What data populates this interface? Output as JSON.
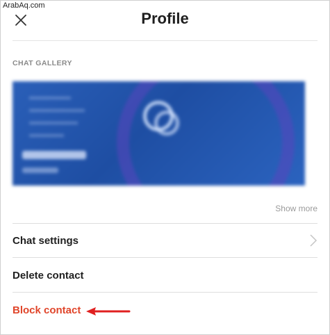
{
  "watermark": "ArabAq.com",
  "header": {
    "title": "Profile"
  },
  "gallery": {
    "section_label": "CHAT GALLERY",
    "show_more": "Show more"
  },
  "menu": {
    "chat_settings": "Chat settings",
    "delete_contact": "Delete contact",
    "block_contact": "Block contact"
  },
  "colors": {
    "danger": "#e0452a",
    "arrow": "#e02020"
  },
  "icons": {
    "close": "close-icon",
    "chevron": "chevron-right-icon"
  }
}
